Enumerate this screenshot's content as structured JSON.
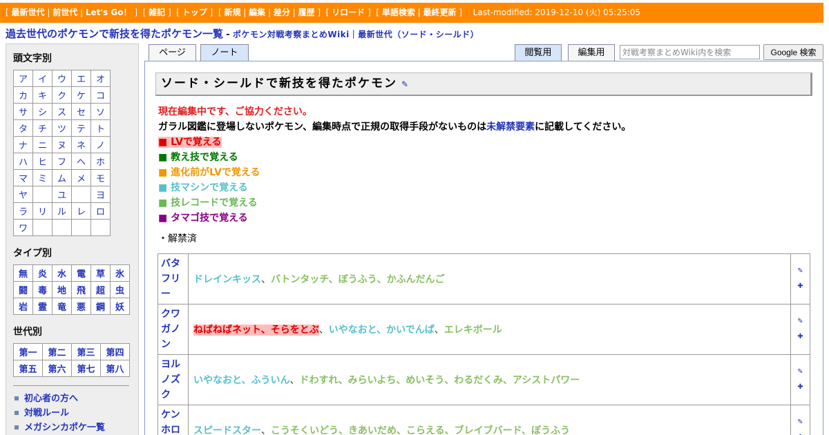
{
  "topbar": {
    "groups": [
      [
        "最新世代",
        "前世代",
        "Let's Go！"
      ],
      [
        "雑記"
      ],
      [
        "トップ"
      ],
      [
        "新規",
        "編集",
        "差分",
        "履歴"
      ],
      [
        "リロード"
      ],
      [
        "単語検索",
        "最終更新"
      ]
    ],
    "last_modified": "Last-modified: 2019-12-10 (火) 05:25:05"
  },
  "page_title": {
    "main": "過去世代のポケモンで新技を得たポケモン一覧",
    "dash": "-",
    "sub": "ポケモン対戦考察まとめWiki｜最新世代（ソード・シールド）"
  },
  "sidebar": {
    "kana_heading": "頭文字別",
    "kana": [
      [
        "ア",
        "イ",
        "ウ",
        "エ",
        "オ"
      ],
      [
        "カ",
        "キ",
        "ク",
        "ケ",
        "コ"
      ],
      [
        "サ",
        "シ",
        "ス",
        "セ",
        "ソ"
      ],
      [
        "タ",
        "チ",
        "ツ",
        "テ",
        "ト"
      ],
      [
        "ナ",
        "ニ",
        "ヌ",
        "ネ",
        "ノ"
      ],
      [
        "ハ",
        "ヒ",
        "フ",
        "ヘ",
        "ホ"
      ],
      [
        "マ",
        "ミ",
        "ム",
        "メ",
        "モ"
      ],
      [
        "ヤ",
        "",
        "ユ",
        "",
        "ヨ"
      ],
      [
        "ラ",
        "リ",
        "ル",
        "レ",
        "ロ"
      ],
      [
        "ワ",
        "",
        "",
        "",
        ""
      ]
    ],
    "type_heading": "タイプ別",
    "types": [
      [
        "無",
        "炎",
        "水",
        "電",
        "草",
        "氷"
      ],
      [
        "闘",
        "毒",
        "地",
        "飛",
        "超",
        "虫"
      ],
      [
        "岩",
        "霊",
        "竜",
        "悪",
        "鋼",
        "妖"
      ]
    ],
    "gen_heading": "世代別",
    "gens": [
      [
        "第一",
        "第二",
        "第三",
        "第四"
      ],
      [
        "第五",
        "第六",
        "第七",
        "第八"
      ]
    ],
    "links": [
      "初心者の方へ",
      "対戦ルール",
      "メガシンカポケ一覧"
    ]
  },
  "tabs": {
    "page": "ページ",
    "note": "ノート",
    "view": "閲覧用",
    "edit": "編集用"
  },
  "search": {
    "placeholder": "対戦考察まとめWiki内を検索",
    "button": "Google 検索"
  },
  "content": {
    "heading": "ソード・シールドで新技を得たポケモン",
    "edit_icon": "pencil-icon",
    "notice": "現在編集中です、ご協力ください。",
    "instruction_pre": "ガラル図鑑に登場しないポケモン、編集時点で正規の取得手段がないものは",
    "instruction_link": "未解禁要素",
    "instruction_post": "に記載してください。",
    "legend": [
      {
        "key": "lv",
        "text": "■ LVで覚える"
      },
      {
        "key": "tutor",
        "text": "■ 教え技で覚える"
      },
      {
        "key": "evo",
        "text": "■ 進化前がLVで覚える"
      },
      {
        "key": "tm",
        "text": "■ 技マシンで覚える"
      },
      {
        "key": "tr",
        "text": "■ 技レコードで覚える"
      },
      {
        "key": "egg",
        "text": "■ タマゴ技で覚える"
      }
    ],
    "subnote": "・解禁済"
  },
  "colors": {
    "topbar": "#ff8800",
    "link": "#2233bb",
    "lv": "#dd0000",
    "tutor": "#007700",
    "evo": "#ee9900",
    "tm": "#55c0cc",
    "tr": "#88c060",
    "egg": "#880088"
  },
  "table": {
    "rows": [
      {
        "name": "バタフリー",
        "moves": [
          {
            "t": "tm",
            "text": "ドレインキッス"
          },
          {
            "t": "tr",
            "text": "バトンタッチ、ぼうふう、かふんだんご"
          }
        ]
      },
      {
        "name": "クワガノン",
        "moves": [
          {
            "t": "lv",
            "text": "ねばねばネット、そらをとぶ"
          },
          {
            "t": "tm",
            "text": "いやなおと、かいでんぱ"
          },
          {
            "t": "tr",
            "text": "エレキボール"
          }
        ]
      },
      {
        "name": "ヨルノズク",
        "moves": [
          {
            "t": "tm",
            "text": "いやなおと、ふういん"
          },
          {
            "t": "tr",
            "text": "ドわすれ、みらいよち、めいそう、わるだくみ、アシストパワー"
          }
        ]
      },
      {
        "name": "ケンホロウ",
        "moves": [
          {
            "t": "tm",
            "text": "スピードスター"
          },
          {
            "t": "tr",
            "text": "こうそくいどう、きあいだめ、こらえる、ブレイブバード、ぼうふう"
          }
        ]
      }
    ],
    "row_icons": [
      "pencil-icon",
      "plus-icon"
    ]
  }
}
